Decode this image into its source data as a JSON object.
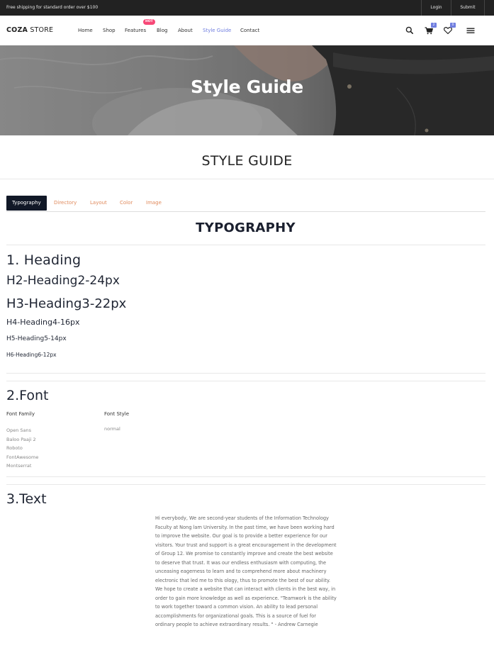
{
  "topbar": {
    "promo": "Free shipping for standard order over $100",
    "login": "Login",
    "submit": "Submit"
  },
  "header": {
    "logo_bold": "COZA",
    "logo_light": " STORE",
    "menu": [
      {
        "label": "Home"
      },
      {
        "label": "Shop"
      },
      {
        "label": "Features"
      },
      {
        "label": "Blog"
      },
      {
        "label": "About"
      },
      {
        "label": "Style Guide"
      },
      {
        "label": "Contact"
      }
    ],
    "hot_badge": "HOT",
    "cart_count": "2",
    "wishlist_count": "0",
    "icons": [
      "search-icon",
      "cart-icon",
      "heart-icon",
      "hamburger-menu-icon"
    ],
    "accent_color": "#717fe0"
  },
  "hero": {
    "title": "Style Guide"
  },
  "main": {
    "heading": "STYLE GUIDE",
    "tabs": [
      {
        "label": "Typography"
      },
      {
        "label": "Directory"
      },
      {
        "label": "Layout"
      },
      {
        "label": "Color"
      },
      {
        "label": "Image"
      }
    ],
    "section_title": "TYPOGRAPHY",
    "headings": {
      "title": "1. Heading",
      "h2": "H2-Heading2-24px",
      "h3": "H3-Heading3-22px",
      "h4": "H4-Heading4-16px",
      "h5": "H5-Heading5-14px",
      "h6": "H6-Heading6-12px"
    },
    "font": {
      "title": "2.Font",
      "family_label": "Font Family",
      "style_label": "Font Style",
      "families": [
        "Open Sans",
        "Baloo Paaji 2",
        "Roboto",
        "FontAwesome",
        "Montserrat"
      ],
      "style": "normal"
    },
    "text": {
      "title": "3.Text",
      "paragraph": "Hi everybody, We are second-year students of the Information Technology Faculty at Nong lam University. In the past time, we have been working hard to improve the website. Our goal is to provide a better experience for our visitors. Your trust and support is a great encouragement in the development of Group 12. We promise to constantly improve and create the best website to deserve that trust. It was our endless enthusiasm with computing, the unceasing eagerness to learn and to comprehend more about machinery electronic that led me to this ology, thus to promote the best of our ability. We hope to create a website that can interact with clients in the best way, in order to gain more knowledge as well as experience. \"Teamwork is the ability to work together toward a common vision. An ability to lead personal accomplishments for organizational goals. This is a source of fuel for ordinary people to achieve extraordinary results. \" - Andrew Carnegie"
    },
    "tab_active_color": "#111827",
    "tab_color": "#e08a5c"
  }
}
